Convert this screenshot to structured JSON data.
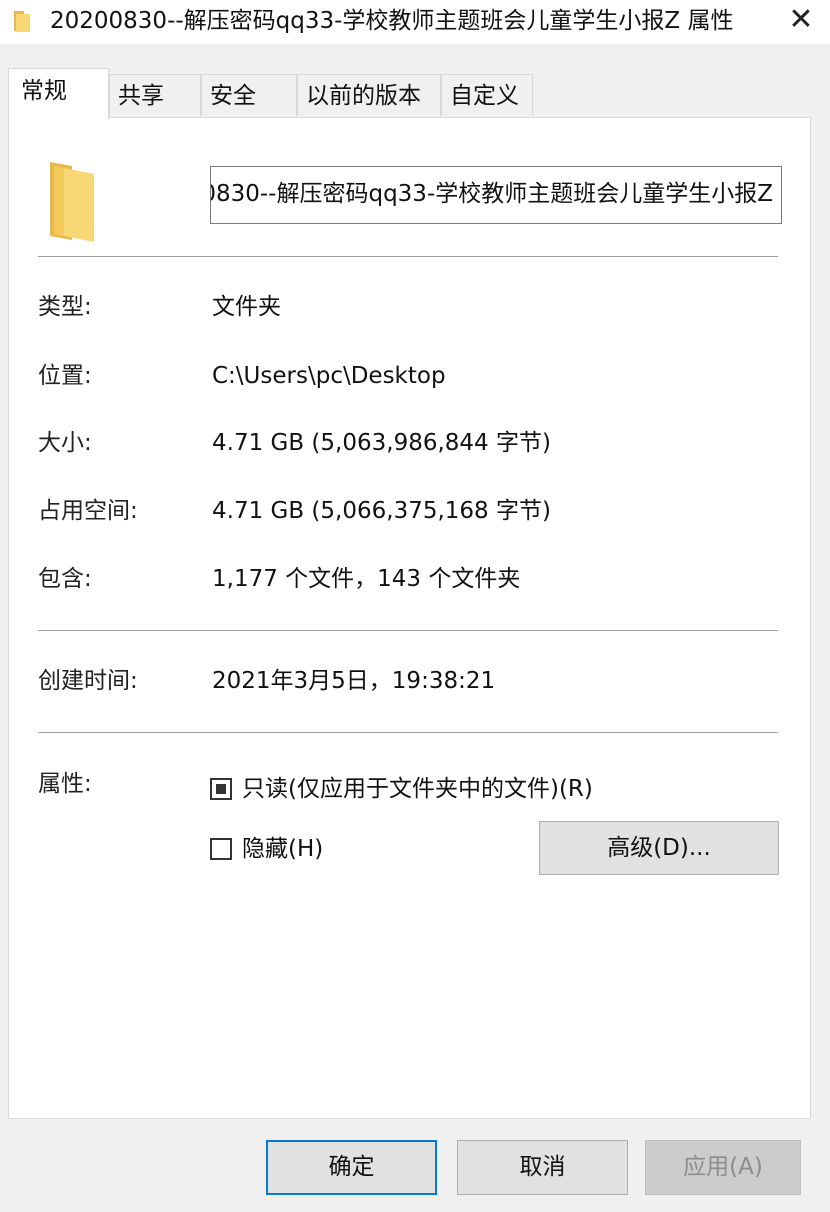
{
  "window": {
    "title": "20200830--解压密码qq33-学校教师主题班会儿童学生小报Z 属性",
    "title_icon": "folder-icon",
    "close_glyph": "✕"
  },
  "tabs": [
    {
      "label": "常规",
      "active": true
    },
    {
      "label": "共享",
      "active": false
    },
    {
      "label": "安全",
      "active": false
    },
    {
      "label": "以前的版本",
      "active": false
    },
    {
      "label": "自定义",
      "active": false
    }
  ],
  "general": {
    "folder_name": "20200830--解压密码qq33-学校教师主题班会儿童学生小报Z",
    "type_label": "类型:",
    "type_value": "文件夹",
    "location_label": "位置:",
    "location_value": "C:\\Users\\pc\\Desktop",
    "size_label": "大小:",
    "size_value": "4.71 GB (5,063,986,844 字节)",
    "size_on_disk_label": "占用空间:",
    "size_on_disk_value": "4.71 GB (5,066,375,168 字节)",
    "contains_label": "包含:",
    "contains_value": "1,177 个文件，143 个文件夹",
    "created_label": "创建时间:",
    "created_value": "2021年3月5日，19:38:21",
    "attributes_label": "属性:",
    "readonly_label": "只读(仅应用于文件夹中的文件)(R)",
    "readonly_state": "indeterminate",
    "hidden_label": "隐藏(H)",
    "hidden_checked": false,
    "advanced_button": "高级(D)..."
  },
  "footer": {
    "ok_label": "确定",
    "cancel_label": "取消",
    "apply_label": "应用(A)"
  },
  "colors": {
    "folder_yellow": "#f8d775",
    "folder_dark": "#e8b94a",
    "primary_border": "#0078d7"
  }
}
